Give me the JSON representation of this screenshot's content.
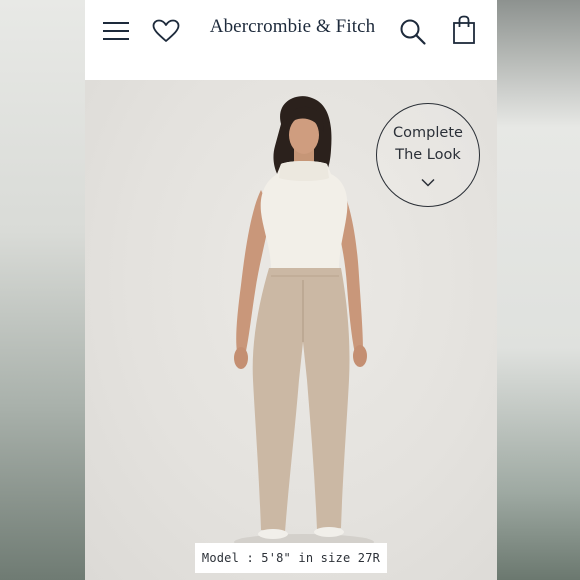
{
  "header": {
    "brand": "Abercrombie & Fitch",
    "icons": [
      "menu-icon",
      "heart-icon",
      "search-icon",
      "bag-icon"
    ]
  },
  "complete_look": {
    "line1": "Complete",
    "line2": "The Look",
    "icon": "chevron-down-icon"
  },
  "product_image": {
    "caption": "Model : 5'8\" in size 27R"
  },
  "colors": {
    "brand_text": "#1d2a3b",
    "header_bg": "#ffffff",
    "photo_bg": "#e6e4e0"
  }
}
